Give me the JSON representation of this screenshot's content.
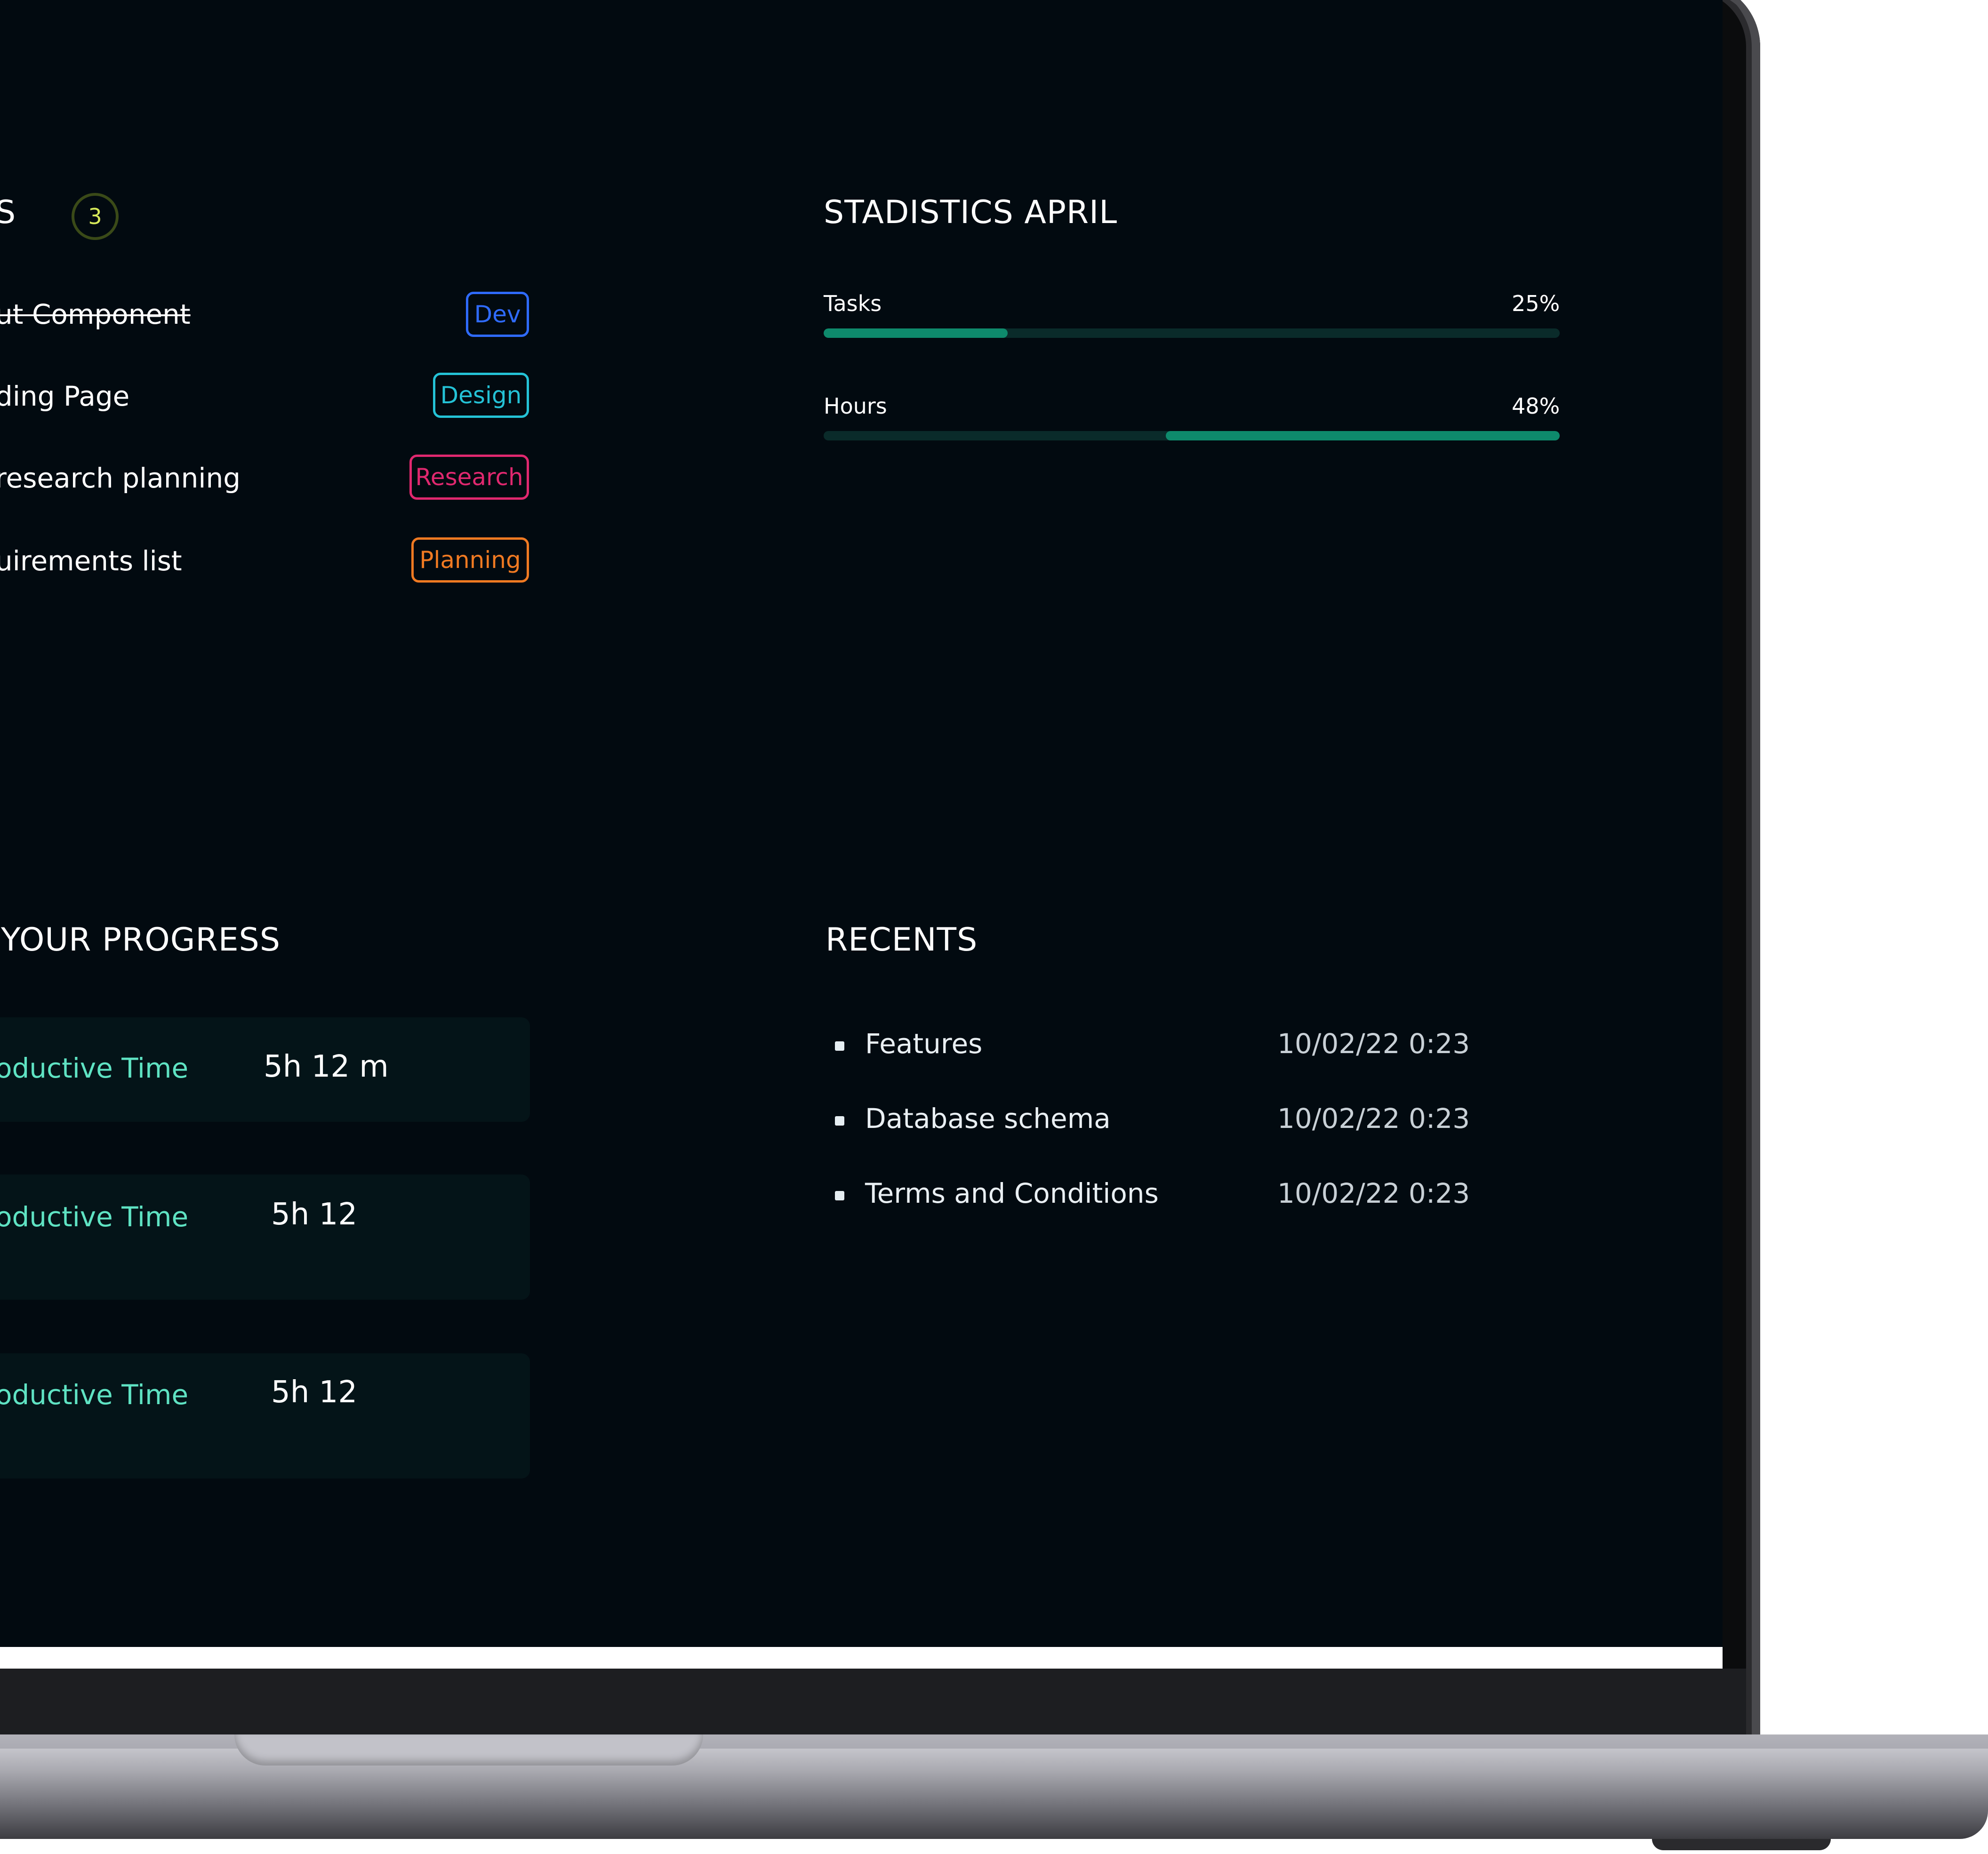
{
  "tasks": {
    "title_fragment": "S",
    "count": "3",
    "items": [
      {
        "text": "ut Component",
        "tag": "Dev",
        "strikethrough": true
      },
      {
        "text": "ding Page",
        "tag": "Design",
        "strikethrough": false
      },
      {
        "text": " research planning",
        "tag": "Research",
        "strikethrough": false
      },
      {
        "text": "uirements list",
        "tag": "Planning",
        "strikethrough": false
      }
    ],
    "tag_colors": {
      "Dev": "#2f6bff",
      "Design": "#24c2d6",
      "Research": "#e0286f",
      "Planning": "#f07a22"
    }
  },
  "statistics": {
    "title": "STADISTICS APRIL",
    "bars": [
      {
        "label": "Tasks",
        "value_text": "25%",
        "value": 0.25
      },
      {
        "label": "Hours",
        "value_text": "48%",
        "value": 0.48
      }
    ],
    "accent_color": "#0e8a6c"
  },
  "progress": {
    "title": "YOUR PROGRESS",
    "cards": [
      {
        "label": "oductive Time",
        "value": "5h 12 m"
      },
      {
        "label": "oductive Time",
        "value": "5h 12"
      },
      {
        "label": "oductive Time",
        "value": "5h 12"
      }
    ]
  },
  "recents": {
    "title": "RECENTS",
    "items": [
      {
        "name": "Features",
        "date": "10/02/22 0:23"
      },
      {
        "name": "Database schema",
        "date": "10/02/22 0:23"
      },
      {
        "name": "Terms and Conditions",
        "date": "10/02/22 0:23"
      }
    ]
  }
}
